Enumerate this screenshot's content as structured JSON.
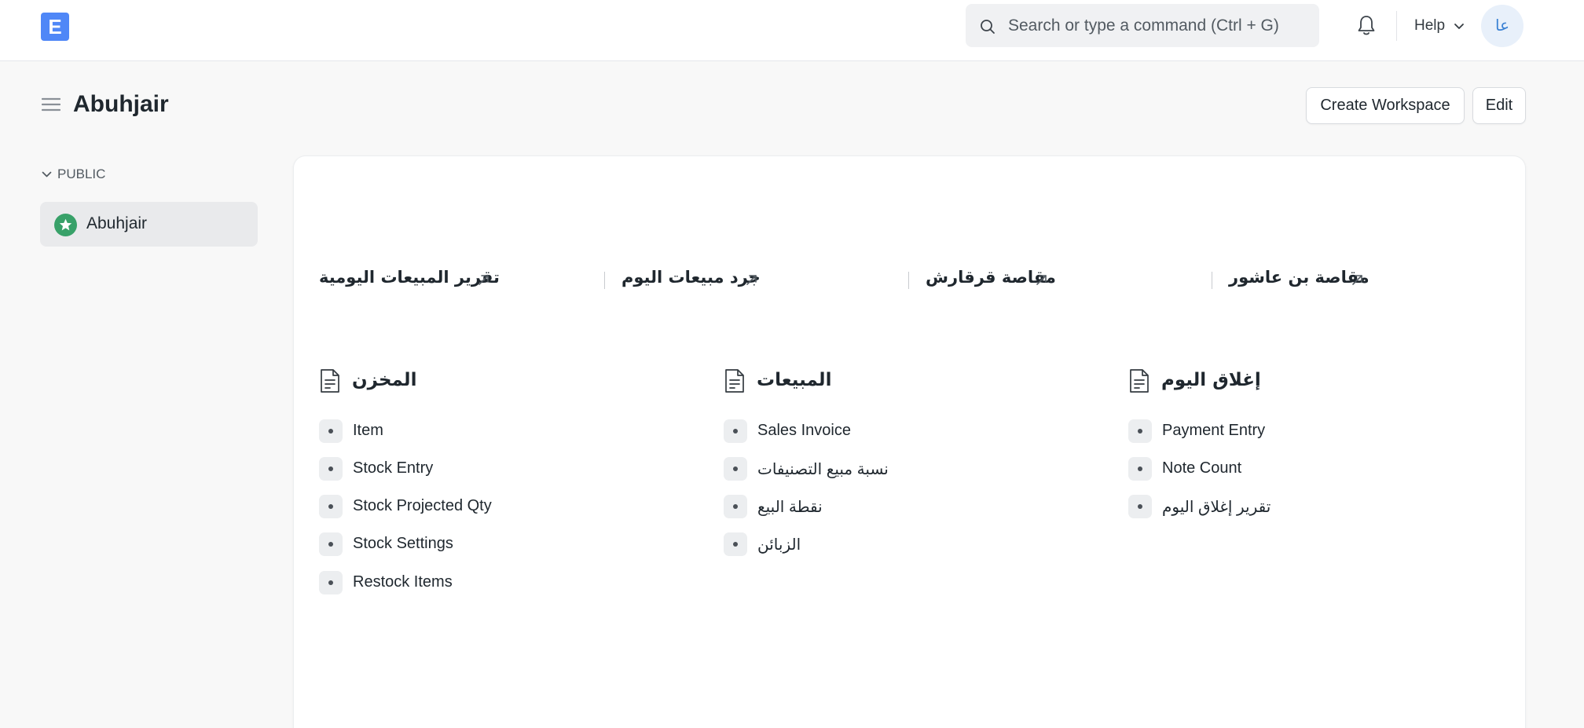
{
  "navbar": {
    "logo_letter": "E",
    "search_placeholder": "Search or type a command (Ctrl + G)",
    "help_label": "Help",
    "avatar_initials": "عا"
  },
  "page": {
    "title": "Abuhjair",
    "create_workspace_label": "Create Workspace",
    "edit_label": "Edit"
  },
  "sidebar": {
    "section_label": "PUBLIC",
    "items": [
      {
        "label": "Abuhjair",
        "icon": "star-icon"
      }
    ]
  },
  "shortcuts": [
    {
      "label": "تقرير المبيعات اليومية"
    },
    {
      "label": "جرد مبيعات اليوم"
    },
    {
      "label": "مقاصة قرقارش"
    },
    {
      "label": "مقاصة بن عاشور"
    }
  ],
  "cards": [
    {
      "title": "المخزن",
      "links": [
        "Item",
        "Stock Entry",
        "Stock Projected Qty",
        "Stock Settings",
        "Restock Items"
      ]
    },
    {
      "title": "المبيعات",
      "links": [
        "Sales Invoice",
        "نسبة مبيع التصنيفات",
        "نقطة البيع",
        "الزبائن"
      ]
    },
    {
      "title": "إغلاق اليوم",
      "links": [
        "Payment Entry",
        "Note Count",
        "تقرير إغلاق اليوم"
      ]
    }
  ],
  "colors": {
    "brand": "#4f87f7",
    "sidebar_active": "#e9eaec",
    "star_badge": "#38a169"
  }
}
